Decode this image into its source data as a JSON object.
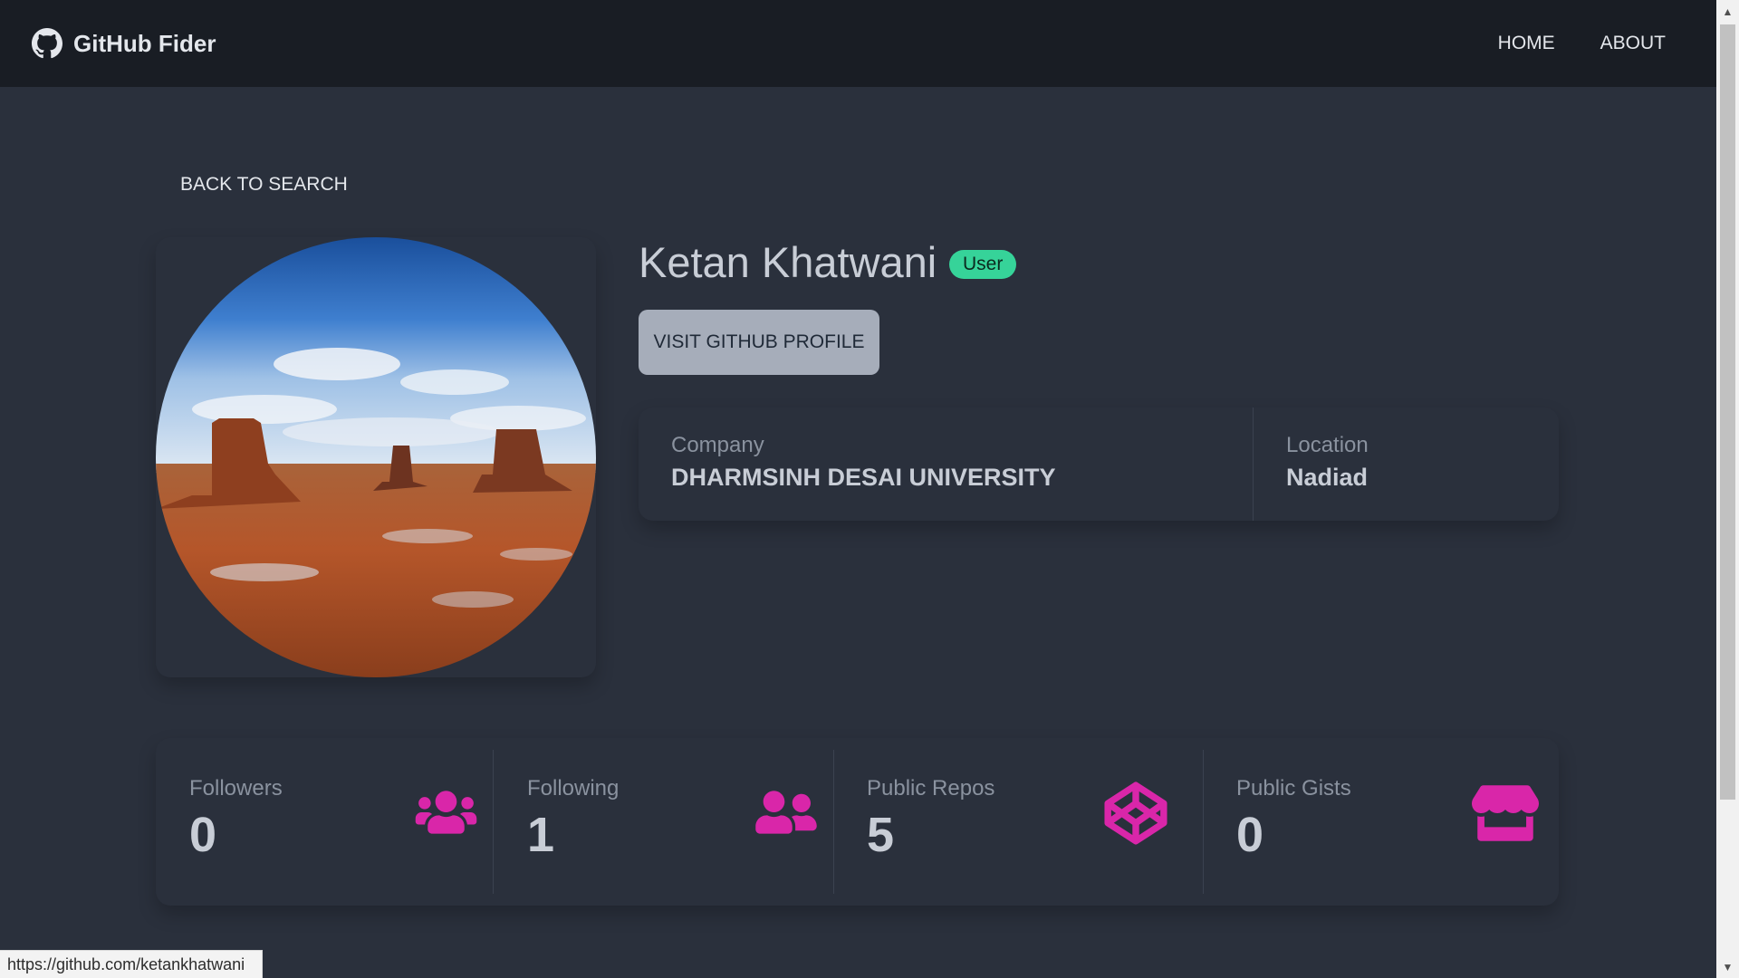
{
  "navbar": {
    "brand": "GitHub Fider",
    "brand_icon": "github-icon",
    "links": [
      "HOME",
      "ABOUT"
    ]
  },
  "back_link": "BACK TO SEARCH",
  "profile": {
    "name": "Ketan Khatwani",
    "badge": "User",
    "visit_button": "VISIT GITHUB PROFILE",
    "company_label": "Company",
    "company_value": "DHARMSINH DESAI UNIVERSITY",
    "location_label": "Location",
    "location_value": "Nadiad"
  },
  "stats": [
    {
      "label": "Followers",
      "value": "0",
      "icon": "users-icon"
    },
    {
      "label": "Following",
      "value": "1",
      "icon": "user-friends-icon"
    },
    {
      "label": "Public Repos",
      "value": "5",
      "icon": "codepen-icon"
    },
    {
      "label": "Public Gists",
      "value": "0",
      "icon": "store-icon"
    }
  ],
  "status_bar": "https://github.com/ketankhatwani",
  "colors": {
    "navbar_bg": "#191d24",
    "page_bg": "#2a303c",
    "accent_icon": "#d926a9",
    "badge_bg": "#36d399",
    "button_bg": "#a6adba"
  }
}
